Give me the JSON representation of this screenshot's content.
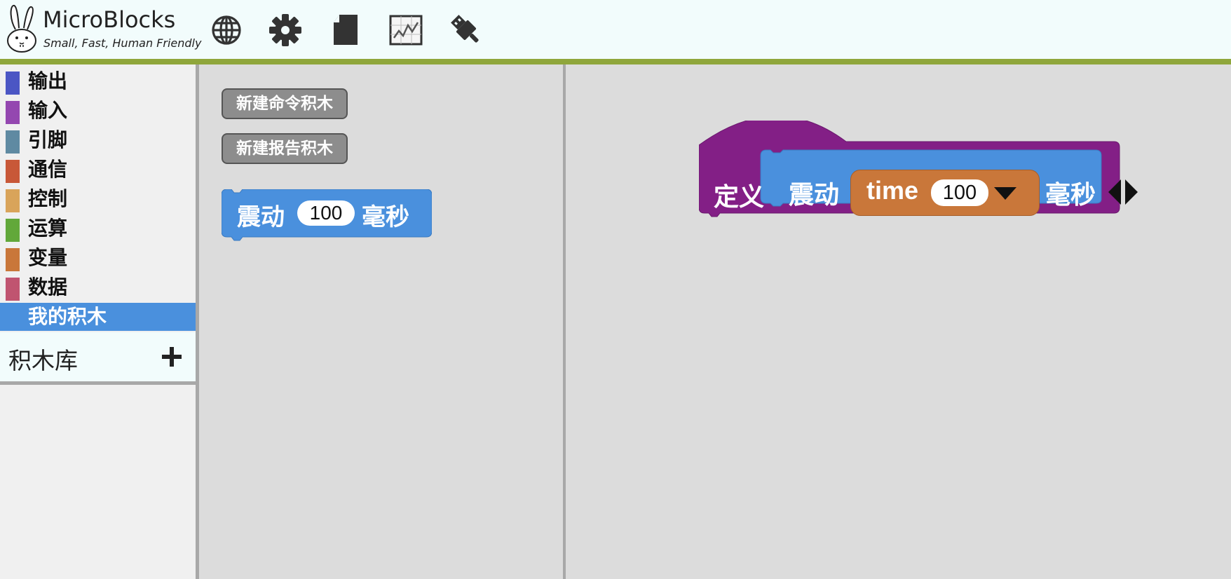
{
  "app": {
    "name": "MicroBlocks",
    "tagline": "Small, Fast, Human Friendly"
  },
  "toolbar": {
    "icons": [
      "globe-icon",
      "gear-icon",
      "file-icon",
      "graph-icon",
      "usb-icon"
    ]
  },
  "categories": [
    {
      "label": "输出",
      "color": "#4b56c4",
      "selected": false
    },
    {
      "label": "输入",
      "color": "#9447b0",
      "selected": false
    },
    {
      "label": "引脚",
      "color": "#5f8aa2",
      "selected": false
    },
    {
      "label": "通信",
      "color": "#c85838",
      "selected": false
    },
    {
      "label": "控制",
      "color": "#d9a45a",
      "selected": false
    },
    {
      "label": "运算",
      "color": "#62a83a",
      "selected": false
    },
    {
      "label": "变量",
      "color": "#c9773a",
      "selected": false
    },
    {
      "label": "数据",
      "color": "#c05470",
      "selected": false
    },
    {
      "label": "我的积木",
      "color": "#4a90dd",
      "selected": true
    }
  ],
  "library": {
    "label": "积木库",
    "add_icon": "plus-icon"
  },
  "palette": {
    "new_command_label": "新建命令积木",
    "new_reporter_label": "新建报告积木",
    "vibrate_block": {
      "label": "震动",
      "value": "100",
      "unit": "毫秒",
      "color": "#4a90dd"
    }
  },
  "script": {
    "define_label": "定义",
    "hat_color": "#831f86",
    "prototype": {
      "label": "震动",
      "param_name": "time",
      "param_default": "100",
      "unit": "毫秒",
      "param_color": "#c9773a"
    }
  }
}
